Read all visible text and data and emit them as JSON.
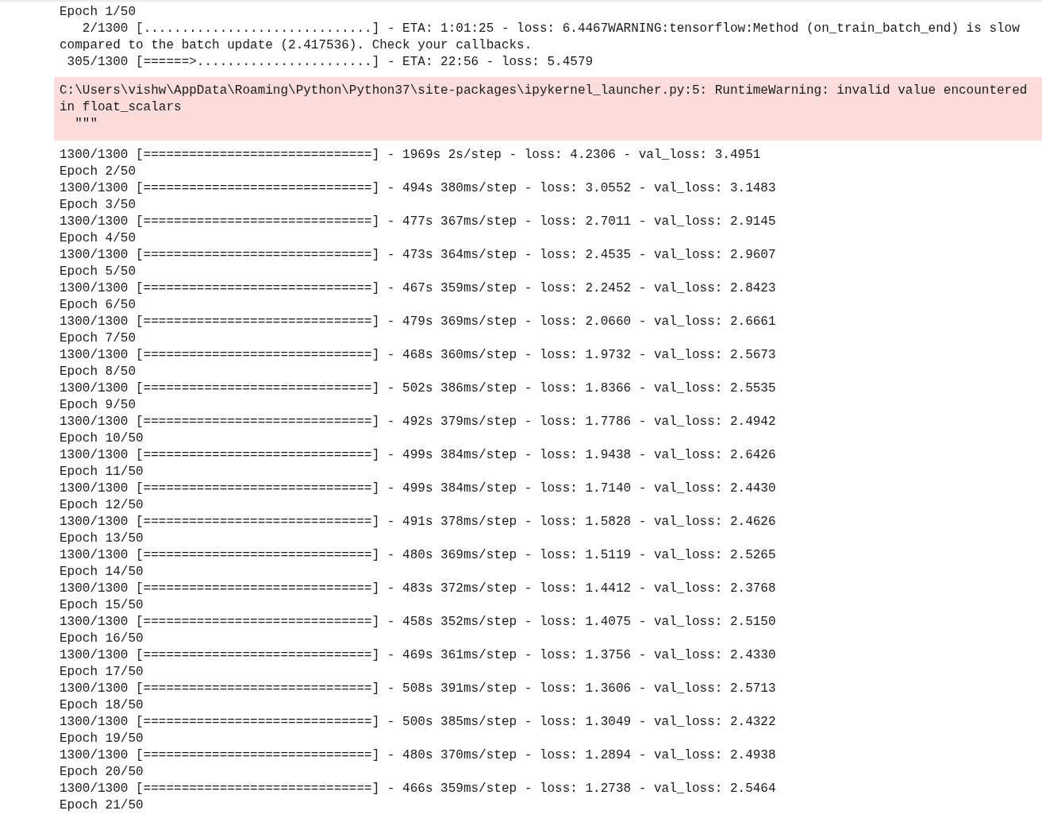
{
  "outputs": [
    {
      "kind": "stream",
      "lines": [
        "Epoch 1/50",
        "   2/1300 [..............................] - ETA: 1:01:25 - loss: 6.4467WARNING:tensorflow:Method (on_train_batch_end) is slow compared to the batch update (2.417536). Check your callbacks.",
        " 305/1300 [======>.......................] - ETA: 22:56 - loss: 5.4579"
      ]
    },
    {
      "kind": "stderr",
      "lines": [
        "C:\\Users\\vishw\\AppData\\Roaming\\Python\\Python37\\site-packages\\ipykernel_launcher.py:5: RuntimeWarning: invalid value encountered in float_scalars",
        "  \"\"\""
      ]
    },
    {
      "kind": "stream",
      "lines": [
        "1300/1300 [==============================] - 1969s 2s/step - loss: 4.2306 - val_loss: 3.4951",
        "Epoch 2/50",
        "1300/1300 [==============================] - 494s 380ms/step - loss: 3.0552 - val_loss: 3.1483",
        "Epoch 3/50",
        "1300/1300 [==============================] - 477s 367ms/step - loss: 2.7011 - val_loss: 2.9145",
        "Epoch 4/50",
        "1300/1300 [==============================] - 473s 364ms/step - loss: 2.4535 - val_loss: 2.9607",
        "Epoch 5/50",
        "1300/1300 [==============================] - 467s 359ms/step - loss: 2.2452 - val_loss: 2.8423",
        "Epoch 6/50",
        "1300/1300 [==============================] - 479s 369ms/step - loss: 2.0660 - val_loss: 2.6661",
        "Epoch 7/50",
        "1300/1300 [==============================] - 468s 360ms/step - loss: 1.9732 - val_loss: 2.5673",
        "Epoch 8/50",
        "1300/1300 [==============================] - 502s 386ms/step - loss: 1.8366 - val_loss: 2.5535",
        "Epoch 9/50",
        "1300/1300 [==============================] - 492s 379ms/step - loss: 1.7786 - val_loss: 2.4942",
        "Epoch 10/50",
        "1300/1300 [==============================] - 499s 384ms/step - loss: 1.9438 - val_loss: 2.6426",
        "Epoch 11/50",
        "1300/1300 [==============================] - 499s 384ms/step - loss: 1.7140 - val_loss: 2.4430",
        "Epoch 12/50",
        "1300/1300 [==============================] - 491s 378ms/step - loss: 1.5828 - val_loss: 2.4626",
        "Epoch 13/50",
        "1300/1300 [==============================] - 480s 369ms/step - loss: 1.5119 - val_loss: 2.5265",
        "Epoch 14/50",
        "1300/1300 [==============================] - 483s 372ms/step - loss: 1.4412 - val_loss: 2.3768",
        "Epoch 15/50",
        "1300/1300 [==============================] - 458s 352ms/step - loss: 1.4075 - val_loss: 2.5150",
        "Epoch 16/50",
        "1300/1300 [==============================] - 469s 361ms/step - loss: 1.3756 - val_loss: 2.4330",
        "Epoch 17/50",
        "1300/1300 [==============================] - 508s 391ms/step - loss: 1.3606 - val_loss: 2.5713",
        "Epoch 18/50",
        "1300/1300 [==============================] - 500s 385ms/step - loss: 1.3049 - val_loss: 2.4322",
        "Epoch 19/50",
        "1300/1300 [==============================] - 480s 370ms/step - loss: 1.2894 - val_loss: 2.4938",
        "Epoch 20/50",
        "1300/1300 [==============================] - 466s 359ms/step - loss: 1.2738 - val_loss: 2.5464",
        "Epoch 21/50"
      ]
    }
  ]
}
